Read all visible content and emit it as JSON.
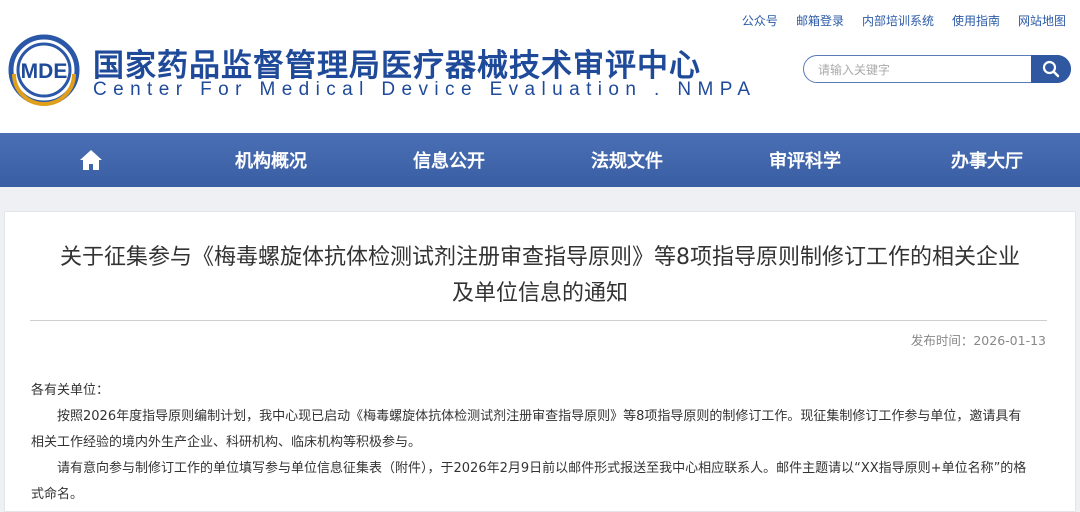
{
  "top_links": [
    "公众号",
    "邮箱登录",
    "内部培训系统",
    "使用指南",
    "网站地图"
  ],
  "logo": {
    "mark": "MDE",
    "title_cn": "国家药品监督管理局医疗器械技术审评中心",
    "title_en": "Center For Medical Device Evaluation . NMPA"
  },
  "search": {
    "placeholder": "请输入关键字"
  },
  "nav": {
    "home_icon": "home-icon",
    "items": [
      "机构概况",
      "信息公开",
      "法规文件",
      "审评科学",
      "办事大厅"
    ]
  },
  "article": {
    "title_line1": "关于征集参与《梅毒螺旋体抗体检测试剂注册审查指导原则》等8项指导原则制修订工作的相关企业",
    "title_line2": "及单位信息的通知",
    "date_label": "发布时间：",
    "date": "2026-01-13",
    "salutation": "各有关单位：",
    "para1": "按照2026年度指导原则编制计划，我中心现已启动《梅毒螺旋体抗体检测试剂注册审查指导原则》等8项指导原则的制修订工作。现征集制修订工作参与单位，邀请具有相关工作经验的境内外生产企业、科研机构、临床机构等积极参与。",
    "para2": "请有意向参与制修订工作的单位填写参与单位信息征集表（附件），于2026年2月9日前以邮件形式报送至我中心相应联系人。邮件主题请以“XX指导原则+单位名称”的格式命名。"
  },
  "colors": {
    "brand_blue": "#1f4a9a",
    "nav_blue": "#3a5ea3",
    "link_blue": "#2b5aa6"
  }
}
